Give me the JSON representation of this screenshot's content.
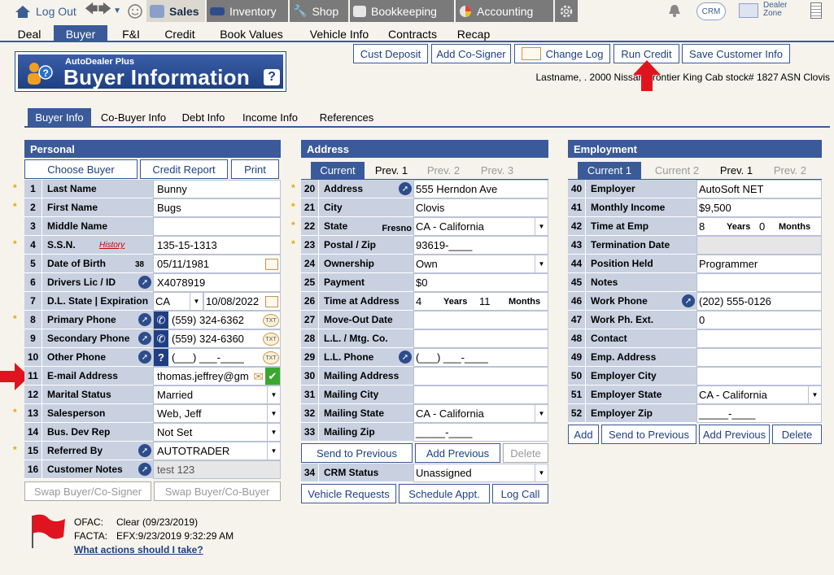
{
  "topnav": {
    "logout": "Log Out",
    "sales": "Sales",
    "inventory": "Inventory",
    "shop": "Shop",
    "bookkeeping": "Bookkeeping",
    "accounting": "Accounting",
    "crm": "CRM",
    "dealer_zone_1": "Dealer",
    "dealer_zone_2": "Zone"
  },
  "subnav": [
    "Deal",
    "Buyer",
    "F&I",
    "Credit",
    "Book Values",
    "Vehicle Info",
    "Contracts",
    "Recap"
  ],
  "logo": {
    "small": "AutoDealer Plus",
    "big": "Buyer Information",
    "help": "?"
  },
  "actions": {
    "cust_deposit": "Cust Deposit",
    "add_cosigner": "Add Co-Signer",
    "change_log": "Change Log",
    "run_credit": "Run Credit",
    "save_customer": "Save Customer Info"
  },
  "customer_line": "Lastname,  .   2000 Nissan Frontier King Cab   stock# 1827  ASN Clovis",
  "section_tabs": [
    "Buyer Info",
    "Co-Buyer Info",
    "Debt Info",
    "Income Info",
    "References"
  ],
  "personal": {
    "title": "Personal",
    "buttons": {
      "choose": "Choose Buyer",
      "credit_report": "Credit Report",
      "print": "Print"
    },
    "rows": [
      {
        "n": "1",
        "label": "Last Name",
        "value": "Bunny"
      },
      {
        "n": "2",
        "label": "First Name",
        "value": "Bugs"
      },
      {
        "n": "3",
        "label": "Middle Name",
        "value": ""
      },
      {
        "n": "4",
        "label": "S.S.N.",
        "value": "135-15-1313",
        "extra": "History"
      },
      {
        "n": "5",
        "label": "Date of Birth",
        "value": "05/11/1981",
        "extra": "38"
      },
      {
        "n": "6",
        "label": "Drivers Lic / ID",
        "value": "X4078919"
      },
      {
        "n": "7",
        "label": "D.L. State | Expiration",
        "value": "CA",
        "value2": "10/08/2022"
      },
      {
        "n": "8",
        "label": "Primary Phone",
        "value": "(559) 324-6362"
      },
      {
        "n": "9",
        "label": "Secondary Phone",
        "value": "(559) 324-6360"
      },
      {
        "n": "10",
        "label": "Other Phone",
        "value": "(___) ___-____"
      },
      {
        "n": "11",
        "label": "E-mail Address",
        "value": "thomas.jeffrey@gm"
      },
      {
        "n": "12",
        "label": "Marital Status",
        "value": "Married"
      },
      {
        "n": "13",
        "label": "Salesperson",
        "value": "Web, Jeff"
      },
      {
        "n": "14",
        "label": "Bus. Dev Rep",
        "value": "Not Set"
      },
      {
        "n": "15",
        "label": "Referred By",
        "value": "AUTOTRADER"
      },
      {
        "n": "16",
        "label": "Customer Notes",
        "value": "test 123"
      }
    ],
    "swap1": "Swap Buyer/Co-Signer",
    "swap2": "Swap Buyer/Co-Buyer",
    "txt": "TXT"
  },
  "address": {
    "title": "Address",
    "tabs": [
      "Current",
      "Prev. 1",
      "Prev. 2",
      "Prev. 3"
    ],
    "rows": [
      {
        "n": "20",
        "label": "Address",
        "value": "555 Herndon Ave"
      },
      {
        "n": "21",
        "label": "City",
        "value": "Clovis"
      },
      {
        "n": "22",
        "label": "State",
        "value": "CA - California",
        "extra": "Fresno"
      },
      {
        "n": "23",
        "label": "Postal / Zip",
        "value": "93619-____"
      },
      {
        "n": "24",
        "label": "Ownership",
        "value": "Own"
      },
      {
        "n": "25",
        "label": "Payment",
        "value": "$0"
      },
      {
        "n": "26",
        "label": "Time at Address",
        "years": "4",
        "years_lbl": "Years",
        "months": "11",
        "months_lbl": "Months"
      },
      {
        "n": "27",
        "label": "Move-Out Date",
        "value": ""
      },
      {
        "n": "28",
        "label": "L.L. / Mtg. Co.",
        "value": ""
      },
      {
        "n": "29",
        "label": "L.L. Phone",
        "value": "(___) ___-____"
      },
      {
        "n": "30",
        "label": "Mailing Address",
        "value": ""
      },
      {
        "n": "31",
        "label": "Mailing City",
        "value": ""
      },
      {
        "n": "32",
        "label": "Mailing State",
        "value": "CA - California"
      },
      {
        "n": "33",
        "label": "Mailing Zip",
        "value": "_____-____"
      }
    ],
    "send_prev": "Send to Previous",
    "add_prev": "Add Previous",
    "delete": "Delete",
    "crm": {
      "n": "34",
      "label": "CRM Status",
      "value": "Unassigned"
    },
    "vehicle_requests": "Vehicle Requests",
    "schedule": "Schedule Appt.",
    "log_call": "Log Call"
  },
  "employment": {
    "title": "Employment",
    "tabs": [
      "Current 1",
      "Current 2",
      "Prev. 1",
      "Prev. 2"
    ],
    "rows": [
      {
        "n": "40",
        "label": "Employer",
        "value": "AutoSoft NET"
      },
      {
        "n": "41",
        "label": "Monthly Income",
        "value": "$9,500"
      },
      {
        "n": "42",
        "label": "Time at Emp",
        "years": "8",
        "years_lbl": "Years",
        "months": "0",
        "months_lbl": "Months"
      },
      {
        "n": "43",
        "label": "Termination Date",
        "value": ""
      },
      {
        "n": "44",
        "label": "Position Held",
        "value": "Programmer"
      },
      {
        "n": "45",
        "label": "Notes",
        "value": ""
      },
      {
        "n": "46",
        "label": "Work Phone",
        "value": "(202) 555-0126"
      },
      {
        "n": "47",
        "label": "Work Ph. Ext.",
        "value": "0"
      },
      {
        "n": "48",
        "label": "Contact",
        "value": ""
      },
      {
        "n": "49",
        "label": "Emp. Address",
        "value": ""
      },
      {
        "n": "50",
        "label": "Employer City",
        "value": ""
      },
      {
        "n": "51",
        "label": "Employer State",
        "value": "CA - California"
      },
      {
        "n": "52",
        "label": "Employer Zip",
        "value": "_____-____"
      }
    ],
    "add": "Add",
    "send_prev": "Send to Previous",
    "add_prev": "Add Previous",
    "delete": "Delete"
  },
  "ofac": {
    "ofac_lbl": "OFAC:",
    "ofac_val": "Clear  (09/23/2019)",
    "facta_lbl": "FACTA:",
    "facta_val": "EFX:9/23/2019 9:32:29 AM",
    "link": "What actions should I take?"
  },
  "colors": {
    "accent": "#3a5a9a",
    "label_bg": "#c9d0e0",
    "arrow": "#e0141e"
  }
}
